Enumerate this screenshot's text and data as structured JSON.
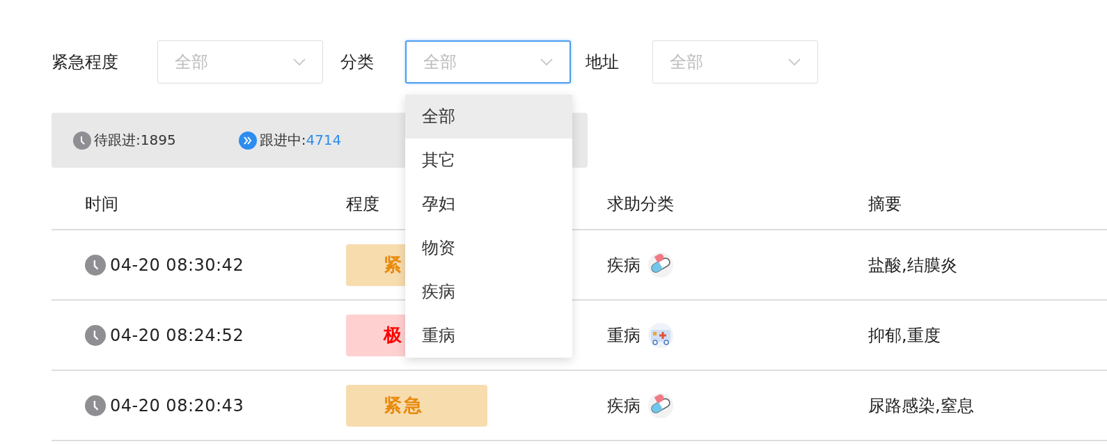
{
  "filters": [
    {
      "label": "紧急程度",
      "placeholder": "全部",
      "focused": false
    },
    {
      "label": "分类",
      "placeholder": "全部",
      "focused": true
    },
    {
      "label": "地址",
      "placeholder": "全部",
      "focused": false
    }
  ],
  "dropdown": {
    "options": [
      {
        "label": "全部",
        "selected": true
      },
      {
        "label": "其它",
        "selected": false
      },
      {
        "label": "孕妇",
        "selected": false
      },
      {
        "label": "物资",
        "selected": false
      },
      {
        "label": "疾病",
        "selected": false
      },
      {
        "label": "重病",
        "selected": false
      }
    ]
  },
  "status_bar": [
    {
      "kind": "pending",
      "label": "待跟进:",
      "count": "1895"
    },
    {
      "kind": "in_progress",
      "label": "跟进中:",
      "count": "4714"
    }
  ],
  "table": {
    "columns": [
      "时间",
      "程度",
      "求助分类",
      "摘要"
    ],
    "rows": [
      {
        "time": "04-20 08:30:42",
        "level": {
          "kind": "urgent",
          "text": "紧"
        },
        "category": {
          "kind": "pill",
          "text": "疾病"
        },
        "summary": "盐酸,结膜炎"
      },
      {
        "time": "04-20 08:24:52",
        "level": {
          "kind": "critical",
          "text": "极"
        },
        "category": {
          "kind": "ambulance",
          "text": "重病"
        },
        "summary": "抑郁,重度"
      },
      {
        "time": "04-20 08:20:43",
        "level": {
          "kind": "urgent",
          "text": "紧急"
        },
        "category": {
          "kind": "pill",
          "text": "疾病"
        },
        "summary": "尿路感染,窒息"
      }
    ]
  }
}
